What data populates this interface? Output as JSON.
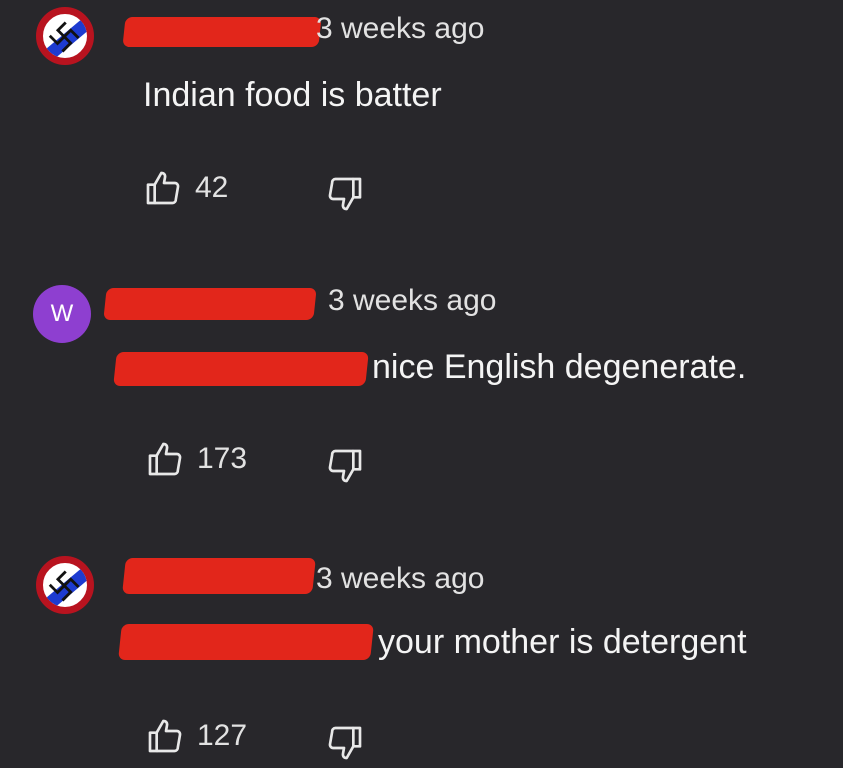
{
  "comments": [
    {
      "avatar_icon": "flag-emblem-icon",
      "timestamp": "3 weeks ago",
      "text": "Indian food is batter",
      "likes": "42"
    },
    {
      "avatar_letter": "W",
      "avatar_color": "#8e3fd0",
      "timestamp": "3 weeks ago",
      "text": "nice English degenerate.",
      "likes": "173"
    },
    {
      "avatar_icon": "flag-emblem-icon",
      "timestamp": "3 weeks ago",
      "text": "your mother is detergent",
      "likes": "127"
    }
  ],
  "colors": {
    "background": "#28272b",
    "redaction": "#e2261b",
    "text": "#f4f4f4"
  }
}
